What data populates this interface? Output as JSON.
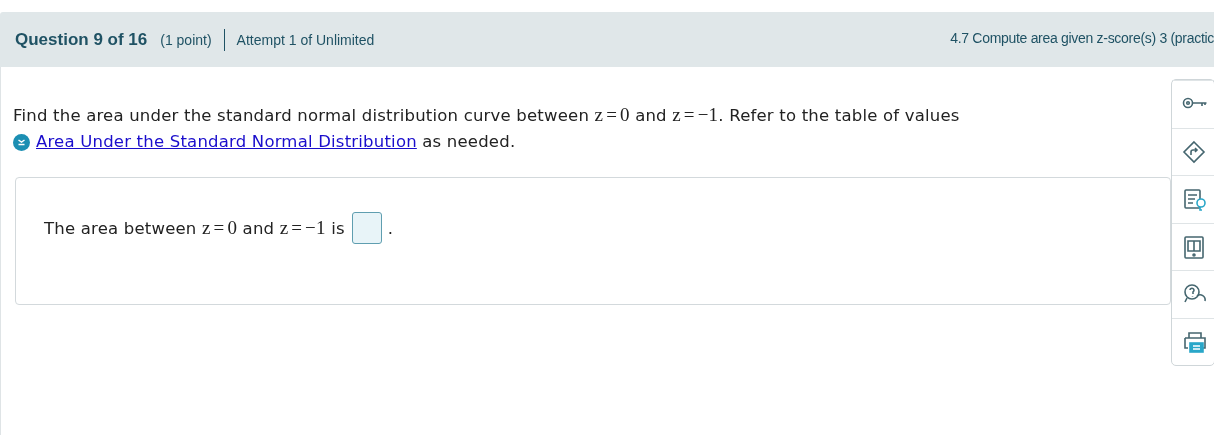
{
  "header": {
    "question": "Question 9 of 16",
    "points": "(1 point)",
    "attempt": "Attempt 1 of Unlimited",
    "topic": "4.7 Compute area given z-score(s) 3 (practic"
  },
  "prompt": [
    {
      "kind": "text",
      "text": "Find the area under the standard normal distribution curve between "
    },
    {
      "kind": "math",
      "text": "z = 0"
    },
    {
      "kind": "text",
      "text": " and "
    },
    {
      "kind": "math",
      "text": "z = −1"
    },
    {
      "kind": "text",
      "text": ". Refer to the table of values"
    }
  ],
  "reference": {
    "link": "Area Under the Standard Normal Distribution",
    "after": " as needed."
  },
  "answer": {
    "parts": [
      {
        "kind": "text",
        "text": "The area between "
      },
      {
        "kind": "math",
        "text": "z = 0"
      },
      {
        "kind": "text",
        "text": " and "
      },
      {
        "kind": "math",
        "text": "z = −1"
      },
      {
        "kind": "text",
        "text": " is"
      }
    ],
    "after": "."
  },
  "tools": [
    {
      "kind": "key"
    },
    {
      "kind": "sign"
    },
    {
      "kind": "notes"
    },
    {
      "kind": "book"
    },
    {
      "kind": "help"
    },
    {
      "kind": "print"
    }
  ]
}
